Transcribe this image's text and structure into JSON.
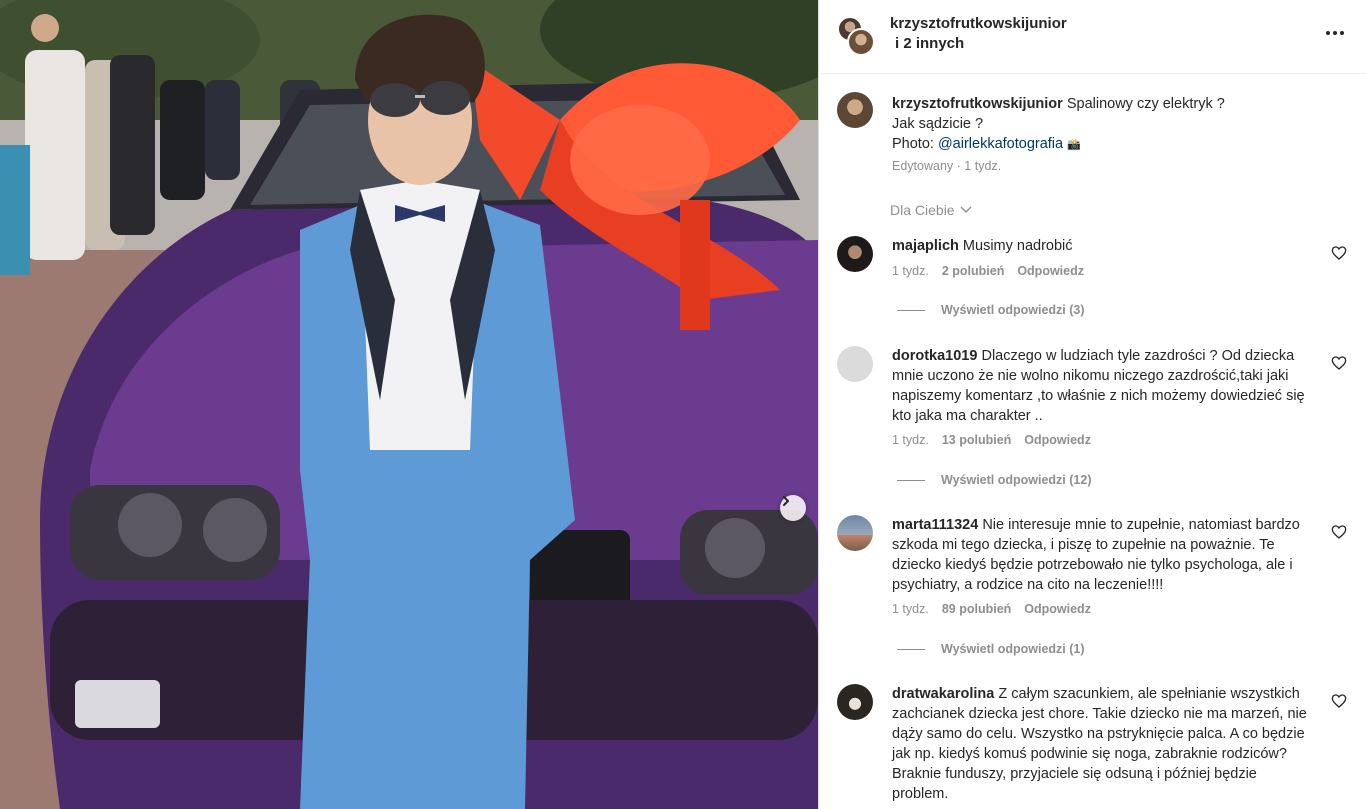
{
  "post": {
    "author": "krzysztofrutkowskijunior",
    "coauthors": "i 2 innych",
    "caption_line1": "Spalinowy czy elektryk ?",
    "caption_line2": "Jak sądzicie ?",
    "photo_prefix": "Photo: ",
    "photo_credit": "@airlekkafotografia",
    "camera_emoji": "📸",
    "edited": "Edytowany",
    "dot": "·",
    "time": "1 tydz."
  },
  "filter_label": "Dla Ciebie",
  "comments": [
    {
      "user": "majaplich",
      "text": "Musimy nadrobić",
      "time": "1 tydz.",
      "likes": "2 polubień",
      "reply": "Odpowiedz",
      "view_replies": "Wyświetl odpowiedzi (3)"
    },
    {
      "user": "dorotka1019",
      "text": "Dlaczego w ludziach tyle zazdrości ? Od dziecka mnie uczono że nie wolno nikomu niczego zazdrościć,taki jaki napiszemy komentarz ,to właśnie z nich możemy dowiedzieć się kto jaka ma charakter ..",
      "time": "1 tydz.",
      "likes": "13 polubień",
      "reply": "Odpowiedz",
      "view_replies": "Wyświetl odpowiedzi (12)"
    },
    {
      "user": "marta111324",
      "text": "Nie interesuje mnie to zupełnie, natomiast bardzo szkoda mi tego dziecka, i piszę to zupełnie na poważnie. Te dziecko kiedyś będzie potrzebowało nie tylko psychologa, ale i psychiatry, a rodzice na cito na leczenie!!!!",
      "time": "1 tydz.",
      "likes": "89 polubień",
      "reply": "Odpowiedz",
      "view_replies": "Wyświetl odpowiedzi (1)"
    },
    {
      "user": "dratwakarolina",
      "text": "Z całym szacunkiem, ale spełnianie wszystkich zachcianek dziecka jest chore. Takie dziecko nie ma marzeń, nie dąży samo do celu. Wszystko na pstryknięcie palca. A co będzie jak np. kiedyś komuś podwinie się noga, zabraknie rodziców? Braknie funduszy, przyjaciele się odsuną i później będzie problem."
    }
  ],
  "icons": {
    "more": "more-options-icon",
    "next": "chevron-right-icon",
    "heart": "heart-outline-icon",
    "filter": "chevron-down-icon"
  }
}
